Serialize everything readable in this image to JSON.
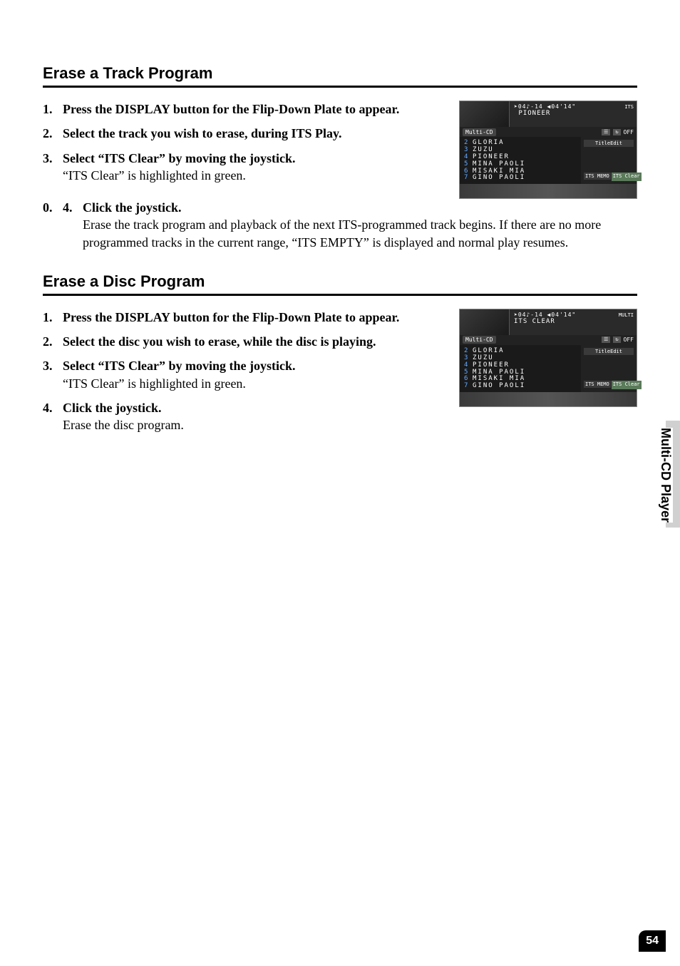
{
  "side_label": "Multi-CD Player",
  "page_number": "54",
  "section1": {
    "heading": "Erase a Track Program",
    "steps": [
      {
        "title": "Press the DISPLAY button for the Flip-Down Plate to appear.",
        "desc": ""
      },
      {
        "title": "Select the track you wish to erase, during ITS Play.",
        "desc": ""
      },
      {
        "title": "Select “ITS Clear” by moving the joystick.",
        "desc": "“ITS Clear” is highlighted in green."
      },
      {
        "title": "Click the joystick.",
        "desc": "Erase the track program and playback of the next ITS-programmed track begins. If there are no more programmed tracks in the current range, “ITS EMPTY” is displayed and normal play resumes."
      }
    ],
    "screenshot": {
      "line1": "➤04♪-14 ◀04'14\"",
      "line2": " PIONEER",
      "corner": "ITS",
      "source_label": "Multi-CD",
      "off": "OFF",
      "list": [
        {
          "idx": "2",
          "name": "GLORIA"
        },
        {
          "idx": "3",
          "name": "ZUZU"
        },
        {
          "idx": "4",
          "name": "PIONEER"
        },
        {
          "idx": "5",
          "name": "MINA PAOLI"
        },
        {
          "idx": "6",
          "name": "MISAKI MIA"
        },
        {
          "idx": "7",
          "name": "GINO PAOLI"
        }
      ],
      "btn_edit": "TitleEdit",
      "btn_memo": "ITS MEMO",
      "btn_clear": "ITS Clear"
    }
  },
  "section2": {
    "heading": "Erase a Disc Program",
    "steps": [
      {
        "title": "Press the DISPLAY button for the Flip-Down Plate to appear.",
        "desc": ""
      },
      {
        "title": "Select the disc you wish to erase, while the disc is playing.",
        "desc": ""
      },
      {
        "title": "Select “ITS Clear” by moving the joystick.",
        "desc": "“ITS Clear” is highlighted in green."
      },
      {
        "title": "Click the joystick.",
        "desc": "Erase the disc program."
      }
    ],
    "screenshot": {
      "line1": "➤04♪-14 ◀04'14\"",
      "line2": "ITS CLEAR",
      "corner": "MULTI",
      "source_label": "Multi-CD",
      "off": "OFF",
      "list": [
        {
          "idx": "2",
          "name": "GLORIA"
        },
        {
          "idx": "3",
          "name": "ZUZU"
        },
        {
          "idx": "4",
          "name": "PIONEER"
        },
        {
          "idx": "5",
          "name": "MINA PAOLI"
        },
        {
          "idx": "6",
          "name": "MISAKI MIA"
        },
        {
          "idx": "7",
          "name": "GINO PAOLI"
        }
      ],
      "btn_edit": "TitleEdit",
      "btn_memo": "ITS MEMO",
      "btn_clear": "ITS Clear"
    }
  }
}
